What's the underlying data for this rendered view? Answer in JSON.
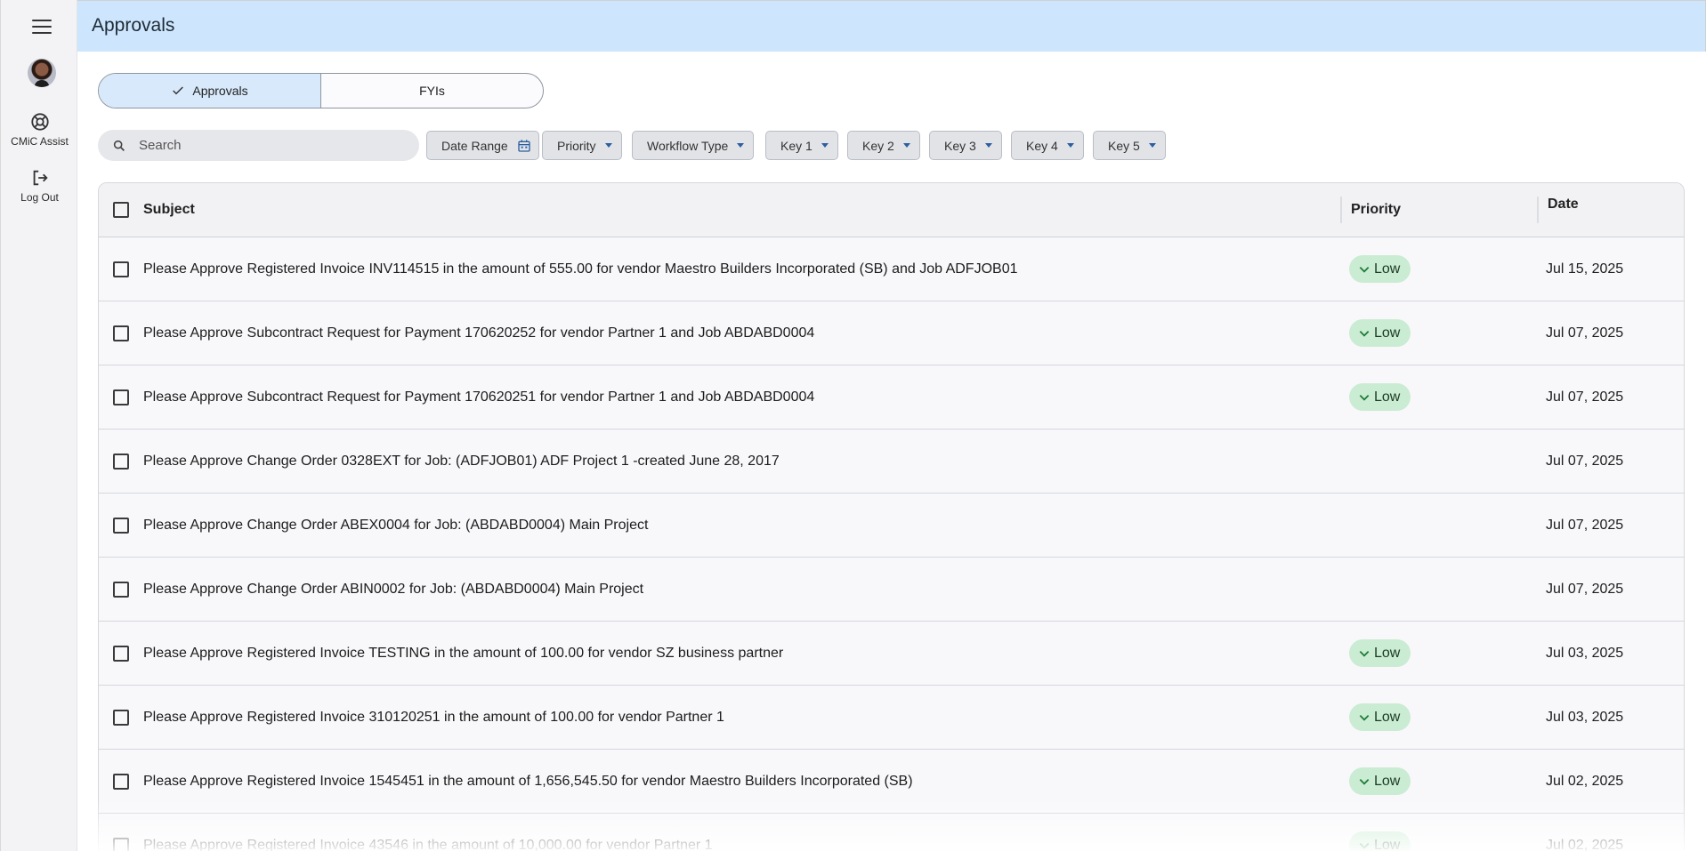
{
  "rail": {
    "menu_icon": "hamburger-menu-icon",
    "assist_label": "CMiC Assist",
    "logout_label": "Log Out"
  },
  "header": {
    "title": "Approvals"
  },
  "tabs": [
    {
      "label": "Approvals",
      "active": true
    },
    {
      "label": "FYIs",
      "active": false
    }
  ],
  "search": {
    "placeholder": "Search"
  },
  "filters": [
    "Date Range",
    "Priority",
    "Workflow Type",
    "Key 1",
    "Key 2",
    "Key 3",
    "Key 4",
    "Key 5"
  ],
  "table": {
    "columns": {
      "subject": "Subject",
      "priority": "Priority",
      "date": "Date"
    },
    "rows": [
      {
        "subject": "Please Approve Registered Invoice INV114515 in the amount of 555.00 for vendor Maestro Builders Incorporated (SB) and Job ADFJOB01",
        "priority": "Low",
        "date": "Jul 15, 2025"
      },
      {
        "subject": "Please Approve Subcontract Request for Payment 170620252 for vendor Partner 1 and Job ABDABD0004",
        "priority": "Low",
        "date": "Jul 07, 2025"
      },
      {
        "subject": "Please Approve Subcontract Request for Payment 170620251 for vendor Partner 1 and Job ABDABD0004",
        "priority": "Low",
        "date": "Jul 07, 2025"
      },
      {
        "subject": "Please Approve Change Order 0328EXT for Job: (ADFJOB01) ADF Project 1 -created June 28, 2017",
        "priority": "",
        "date": "Jul 07, 2025"
      },
      {
        "subject": "Please Approve Change Order ABEX0004 for Job: (ABDABD0004) Main Project",
        "priority": "",
        "date": "Jul 07, 2025"
      },
      {
        "subject": "Please Approve Change Order ABIN0002 for Job: (ABDABD0004) Main Project",
        "priority": "",
        "date": "Jul 07, 2025"
      },
      {
        "subject": "Please Approve Registered Invoice TESTING in the amount of 100.00 for vendor SZ business partner",
        "priority": "Low",
        "date": "Jul 03, 2025"
      },
      {
        "subject": "Please Approve Registered Invoice 310120251 in the amount of 100.00 for vendor Partner 1",
        "priority": "Low",
        "date": "Jul 03, 2025"
      },
      {
        "subject": "Please Approve Registered Invoice 1545451 in the amount of 1,656,545.50 for vendor Maestro Builders Incorporated (SB)",
        "priority": "Low",
        "date": "Jul 02, 2025"
      },
      {
        "subject": "Please Approve Registered Invoice 43546 in the amount of 10,000.00 for vendor Partner 1",
        "priority": "Low",
        "date": "Jul 02, 2025"
      }
    ]
  }
}
